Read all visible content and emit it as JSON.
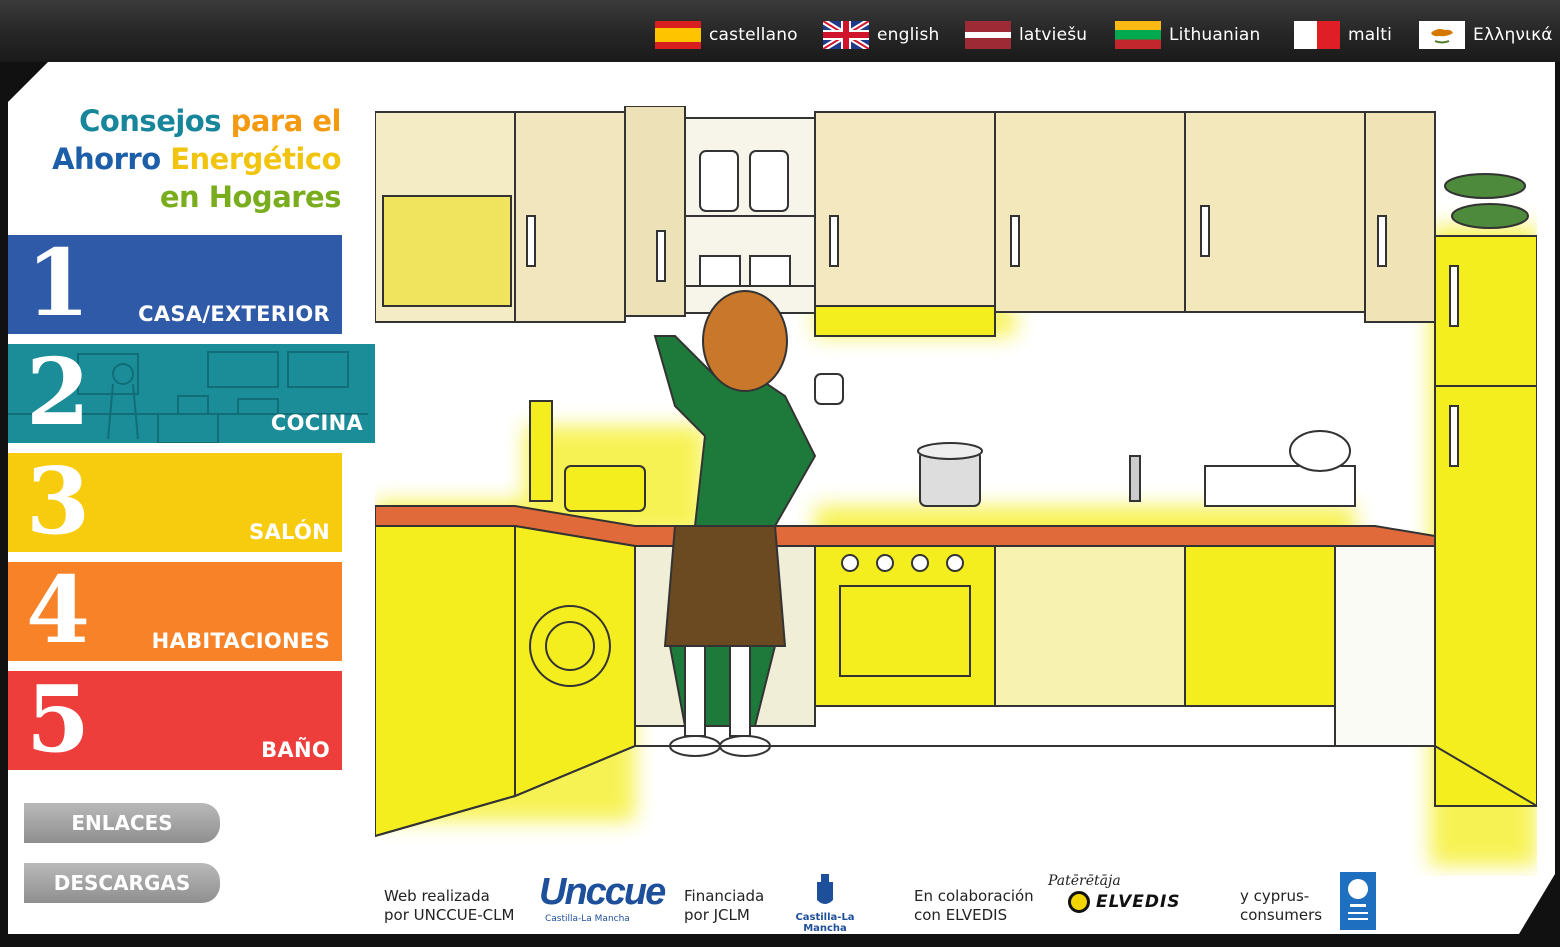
{
  "languages": [
    {
      "label": "castellano",
      "flag": "es"
    },
    {
      "label": "english",
      "flag": "uk"
    },
    {
      "label": "latviešu",
      "flag": "lv"
    },
    {
      "label": "Lithuanian",
      "flag": "lt"
    },
    {
      "label": "malti",
      "flag": "mt"
    },
    {
      "label": "Ελληνικά",
      "flag": "cy"
    }
  ],
  "title": {
    "line1a": "Consejos",
    "line1b": " para el",
    "line2a": "Ahorro",
    "line2b": " Energético",
    "line3": "en Hogares"
  },
  "nav": [
    {
      "num": "1",
      "label": "CASA/EXTERIOR",
      "color": "#2f5aa8"
    },
    {
      "num": "2",
      "label": "COCINA",
      "color": "#1b8d98"
    },
    {
      "num": "3",
      "label": "SALÓN",
      "color": "#f8cc0e"
    },
    {
      "num": "4",
      "label": "HABITACIONES",
      "color": "#f78228"
    },
    {
      "num": "5",
      "label": "BAÑO",
      "color": "#ee3e3b"
    }
  ],
  "links": {
    "enlaces": "ENLACES",
    "descargas": "DESCARGAS"
  },
  "footer": {
    "web_l1": "Web realizada",
    "web_l2": "por UNCCUE-CLM",
    "unccue_logo": "Unccue",
    "unccue_sub": "Castilla-La Mancha",
    "fin_l1": "Financiada",
    "fin_l2": "por JCLM",
    "clm_logo": "Castilla-La Mancha",
    "col_l1": "En colaboración",
    "col_l2": "con ELVEDIS",
    "elvedis_script": "Patērētāja",
    "elvedis_logo": "ELVEDIS",
    "cy_l1": "y cyprus-",
    "cy_l2": "consumers"
  },
  "colors": {
    "accent_yellow": "#f4ee1e",
    "counter_orange": "#e06a3a",
    "apron": "#6b4a22",
    "sweater": "#1e7a3a"
  }
}
